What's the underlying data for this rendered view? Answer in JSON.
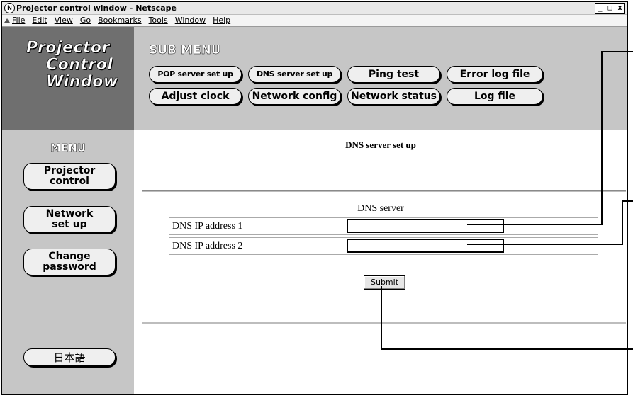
{
  "window": {
    "title": "Projector control window - Netscape",
    "logo_glyph": "N",
    "controls": [
      "_",
      "□",
      "x"
    ]
  },
  "menubar": {
    "items": [
      "File",
      "Edit",
      "View",
      "Go",
      "Bookmarks",
      "Tools",
      "Window",
      "Help"
    ]
  },
  "logo": {
    "lines": [
      "Projector",
      "Control",
      "Window"
    ]
  },
  "submenu": {
    "title": "SUB MENU",
    "buttons": [
      "POP server set up",
      "DNS server set up",
      "Ping test",
      "Error log file",
      "Adjust clock",
      "Network config",
      "Network status",
      "Log file"
    ]
  },
  "leftnav": {
    "title": "MENU",
    "buttons": [
      {
        "line1": "Projector",
        "line2": "control"
      },
      {
        "line1": "Network",
        "line2": "set up"
      },
      {
        "line1": "Change",
        "line2": "password"
      },
      {
        "line1": "日本語",
        "line2": ""
      }
    ]
  },
  "main": {
    "page_title": "DNS server set up",
    "section_title": "DNS server",
    "rows": [
      {
        "label": "DNS IP address 1",
        "value": ""
      },
      {
        "label": "DNS IP address 2",
        "value": ""
      }
    ],
    "submit_label": "Submit"
  }
}
